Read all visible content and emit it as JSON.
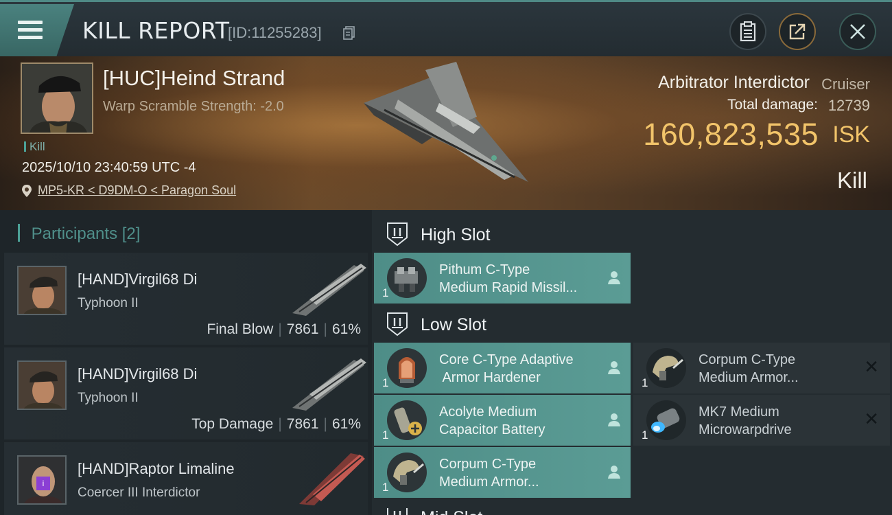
{
  "header": {
    "title": "KILL REPORT",
    "report_id": "[ID:11255283]"
  },
  "victim": {
    "name": "[HUC]Heind Strand",
    "warp_scramble": "Warp Scramble Strength: -2.0",
    "kill_tag": "Kill",
    "timestamp": "2025/10/10 23:40:59 UTC -4",
    "location": "MP5-KR < D9DM-O < Paragon Soul",
    "ship_name": "Arbitrator Interdictor",
    "ship_class": "Cruiser",
    "total_damage_label": "Total damage:",
    "total_damage": "12739",
    "isk_value": "160,823,535",
    "isk_unit": "ISK",
    "result": "Kill"
  },
  "participants": {
    "label": "Participants",
    "count": "[2]",
    "rows": [
      {
        "name": "[HAND]Virgil68 Di",
        "ship": "Typhoon II",
        "role": "Final Blow",
        "damage": "7861",
        "percent": "61%"
      },
      {
        "name": "[HAND]Virgil68 Di",
        "ship": "Typhoon II",
        "role": "Top Damage",
        "damage": "7861",
        "percent": "61%"
      },
      {
        "name": "[HAND]Raptor Limaline",
        "ship": "Coercer III Interdictor",
        "badge": "i"
      }
    ]
  },
  "fitting": {
    "high_slot": {
      "label": "High Slot",
      "modules": [
        {
          "qty": "1",
          "line1": "Pithum C-Type",
          "line2": "Medium Rapid Missil..."
        }
      ]
    },
    "low_slot": {
      "label": "Low Slot",
      "modules_left": [
        {
          "qty": "1",
          "line1": "Core C-Type Adaptive",
          "line2": " Armor Hardener"
        },
        {
          "qty": "1",
          "line1": "Acolyte Medium",
          "line2": "Capacitor Battery"
        },
        {
          "qty": "1",
          "line1": "Corpum C-Type",
          "line2": "Medium Armor..."
        }
      ],
      "modules_right": [
        {
          "qty": "1",
          "line1": "Corpum C-Type",
          "line2": "Medium Armor..."
        },
        {
          "qty": "1",
          "line1": "MK7 Medium",
          "line2": "Microwarpdrive"
        }
      ]
    },
    "mid_slot": {
      "label": "Mid Slot"
    }
  },
  "colors": {
    "accent_teal": "#4f8a86",
    "isk_gold": "#f2c46a",
    "module_fitted": "#5b9c95",
    "module_destroyed": "#2b3337"
  }
}
